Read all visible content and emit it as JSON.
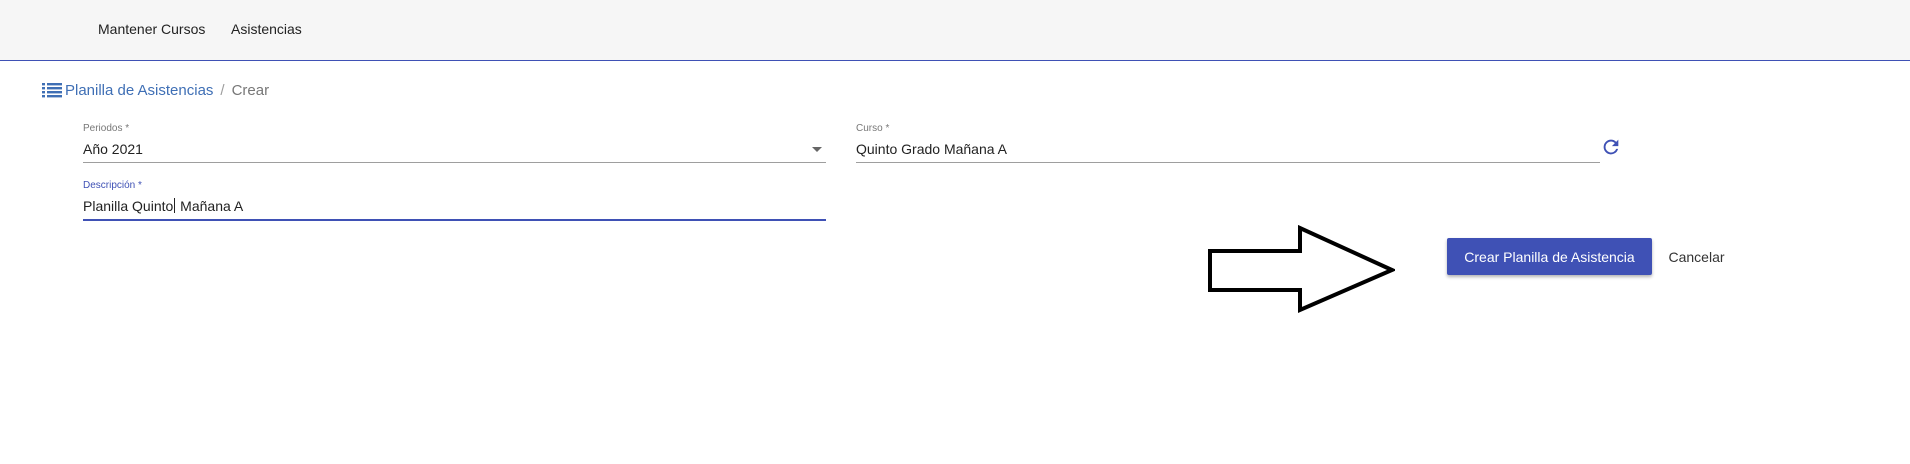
{
  "nav": {
    "items": [
      {
        "label": "Mantener Cursos"
      },
      {
        "label": "Asistencias"
      }
    ]
  },
  "breadcrumb": {
    "icon": "list-icon",
    "link_label": "Planilla de Asistencias",
    "separator": "/",
    "current": "Crear"
  },
  "form": {
    "periodos": {
      "label": "Periodos *",
      "value": "Año 2021",
      "icon": "chevron-down-icon"
    },
    "curso": {
      "label": "Curso *",
      "value": "Quinto Grado Mañana A",
      "icon": "refresh-icon"
    },
    "descripcion": {
      "label": "Descripción *",
      "value_before_caret": "Planilla Quinto",
      "value_after_caret": " Mañana A"
    }
  },
  "actions": {
    "primary_label": "Crear Planilla de Asistencia",
    "cancel_label": "Cancelar"
  },
  "colors": {
    "accent": "#3f51b5",
    "link": "#3f6fb5",
    "topbar_bg": "#f6f6f6"
  },
  "annotation": {
    "icon": "arrow-right-icon"
  }
}
